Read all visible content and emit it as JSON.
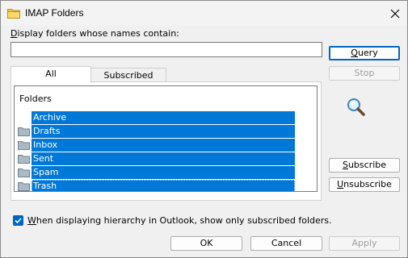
{
  "window": {
    "title": "IMAP Folders"
  },
  "filter": {
    "label_pre": "",
    "label_ul": "D",
    "label_post": "isplay folders whose names contain:",
    "value": "",
    "placeholder": ""
  },
  "buttons": {
    "query": {
      "ul": "Q",
      "rest": "uery"
    },
    "stop": {
      "label": "Stop"
    },
    "subscribe": {
      "ul": "S",
      "rest": "ubscribe"
    },
    "unsubscribe": {
      "ul": "U",
      "rest": "nsubscribe"
    },
    "ok": "OK",
    "cancel": "Cancel",
    "apply": "Apply"
  },
  "tabs": {
    "all": "All",
    "subscribed": "Subscribed"
  },
  "tree": {
    "root": "Folders",
    "items": [
      "Archive",
      "Drafts",
      "Inbox",
      "Sent",
      "Spam",
      "Trash"
    ]
  },
  "option": {
    "checked": true,
    "ul": "W",
    "rest": "hen displaying hierarchy in Outlook, show only subscribed folders."
  },
  "colors": {
    "selection": "#0078d7",
    "accent": "#0067c0"
  }
}
